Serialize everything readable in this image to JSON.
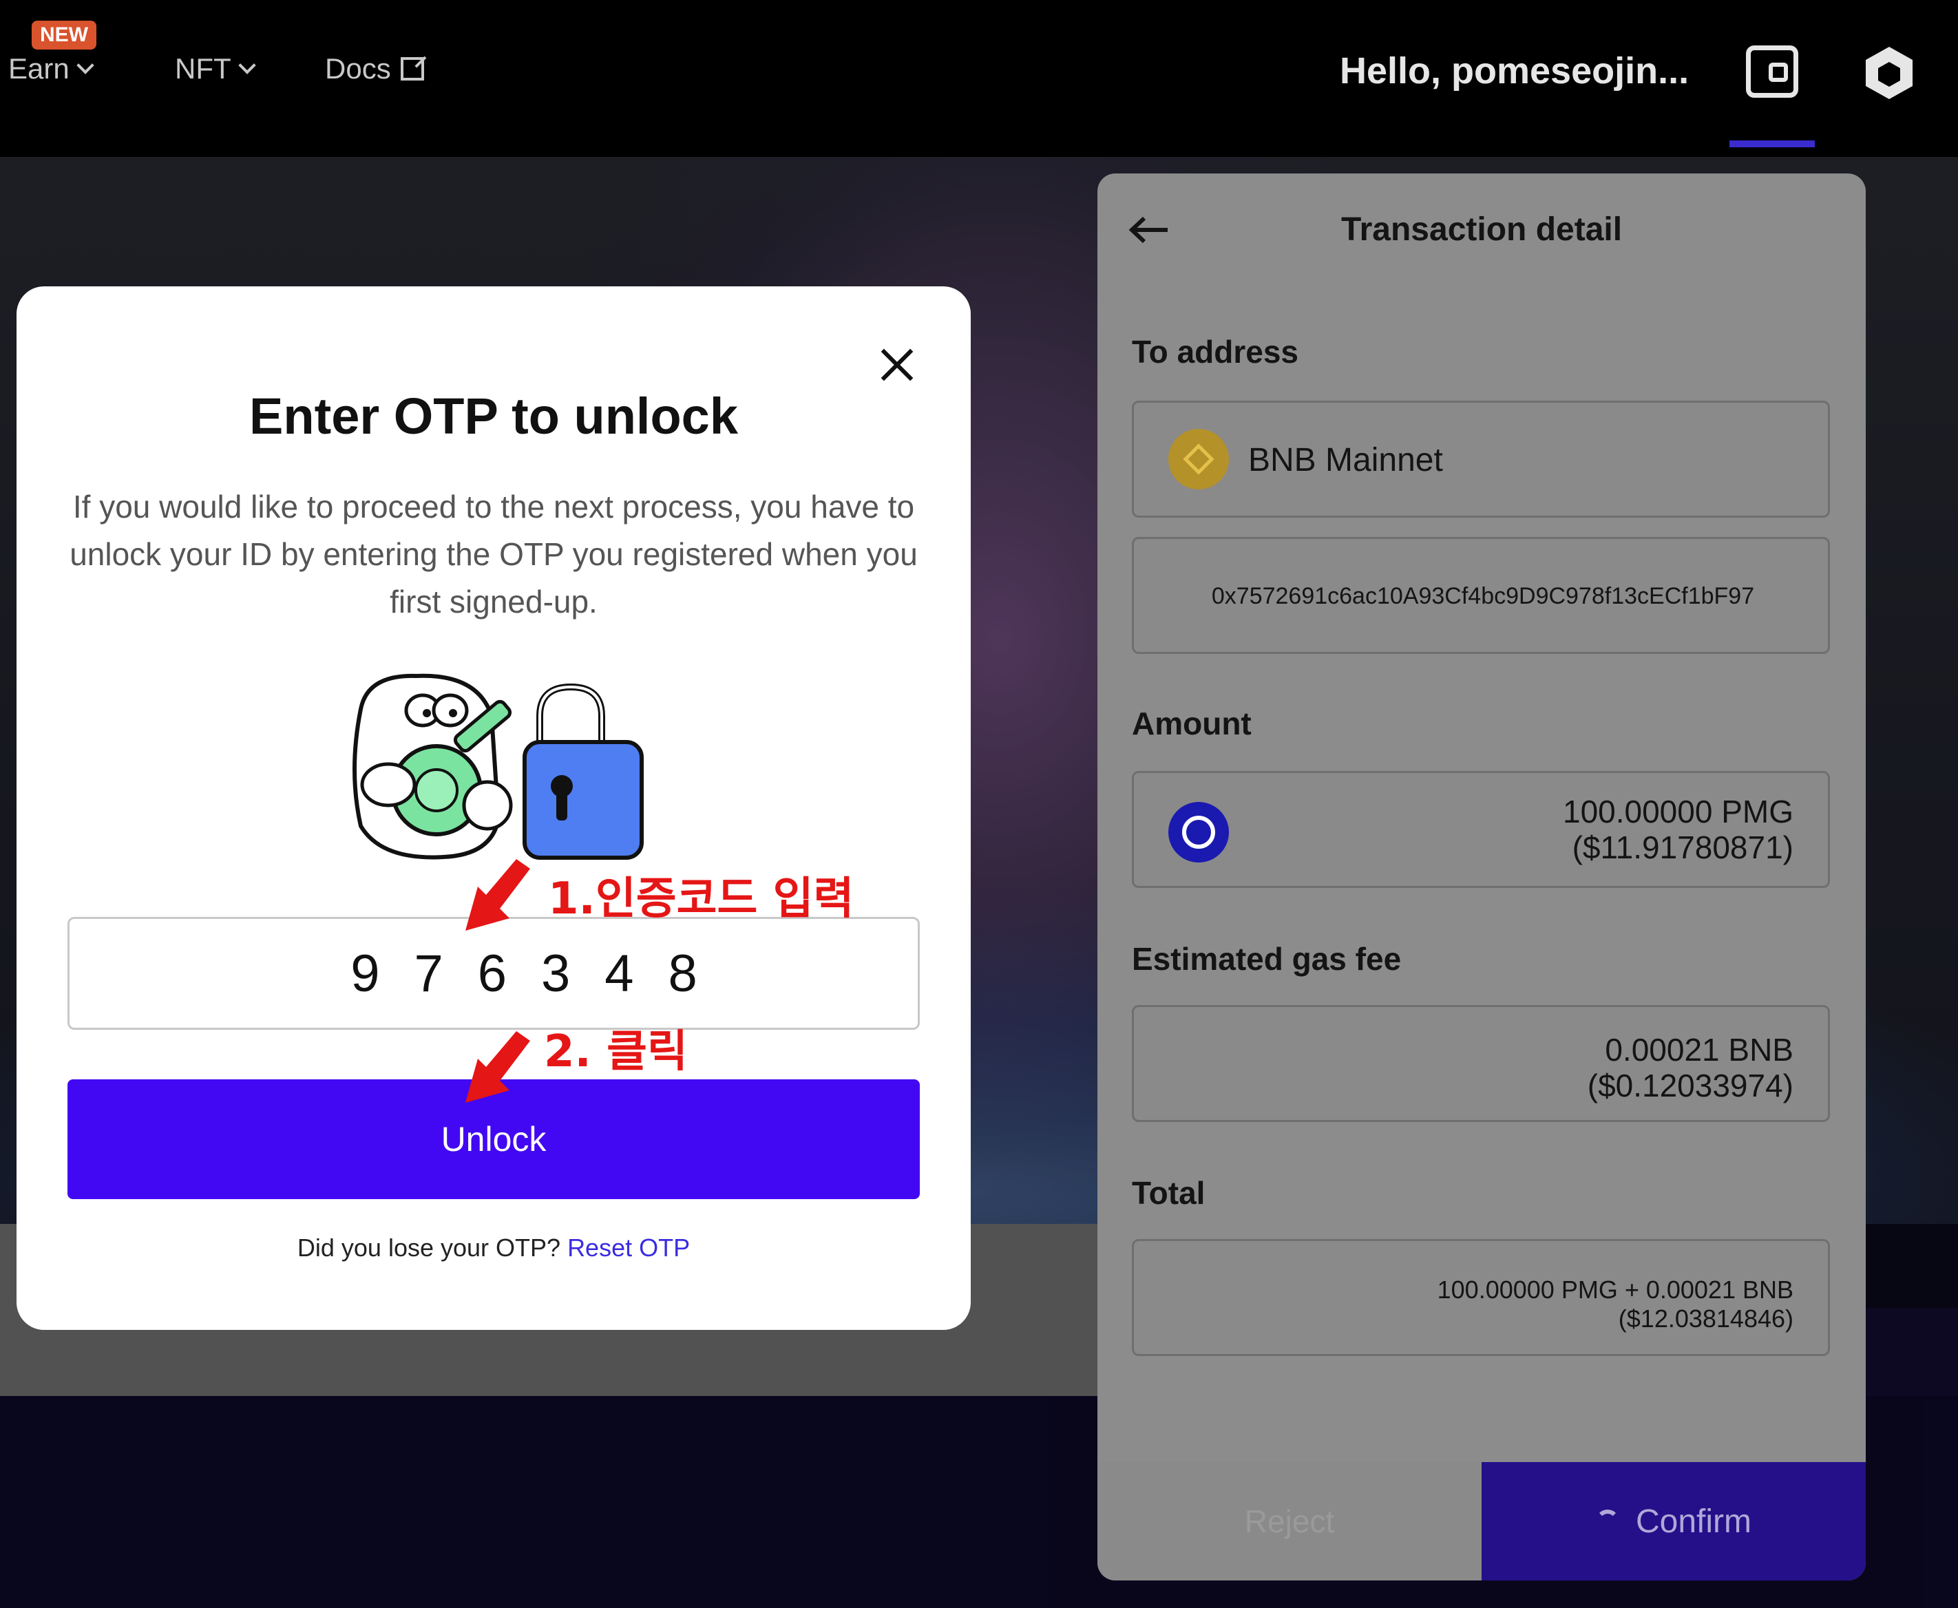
{
  "nav": {
    "badge": "NEW",
    "earn": "Earn",
    "nft": "NFT",
    "docs": "Docs",
    "greeting": "Hello, pomeseojin..."
  },
  "transaction": {
    "title": "Transaction detail",
    "to_address_label": "To address",
    "network": "BNB Mainnet",
    "address": "0x7572691c6ac10A93Cf4bc9D9C978f13cECf1bF97",
    "amount_label": "Amount",
    "amount": "100.00000 PMG",
    "amount_usd": "($11.91780871)",
    "gas_label": "Estimated gas fee",
    "gas": "0.00021 BNB",
    "gas_usd": "($0.12033974)",
    "total_label": "Total",
    "total": "100.00000 PMG + 0.00021 BNB",
    "total_usd": "($12.03814846)",
    "reject": "Reject",
    "confirm": "Confirm"
  },
  "otp_modal": {
    "title": "Enter OTP to unlock",
    "description": "If you would like to proceed to the next process, you have to unlock your ID by entering the OTP you registered when you first signed-up.",
    "otp_value": "976348",
    "unlock": "Unlock",
    "lost_question": "Did you lose your OTP?",
    "reset_link": "Reset OTP"
  },
  "annotations": {
    "step1": "1.인증코드 입력",
    "step2": "2. 클릭"
  },
  "colors": {
    "accent": "#4308f3",
    "annotation": "#e51616",
    "badge": "#d9532d"
  }
}
